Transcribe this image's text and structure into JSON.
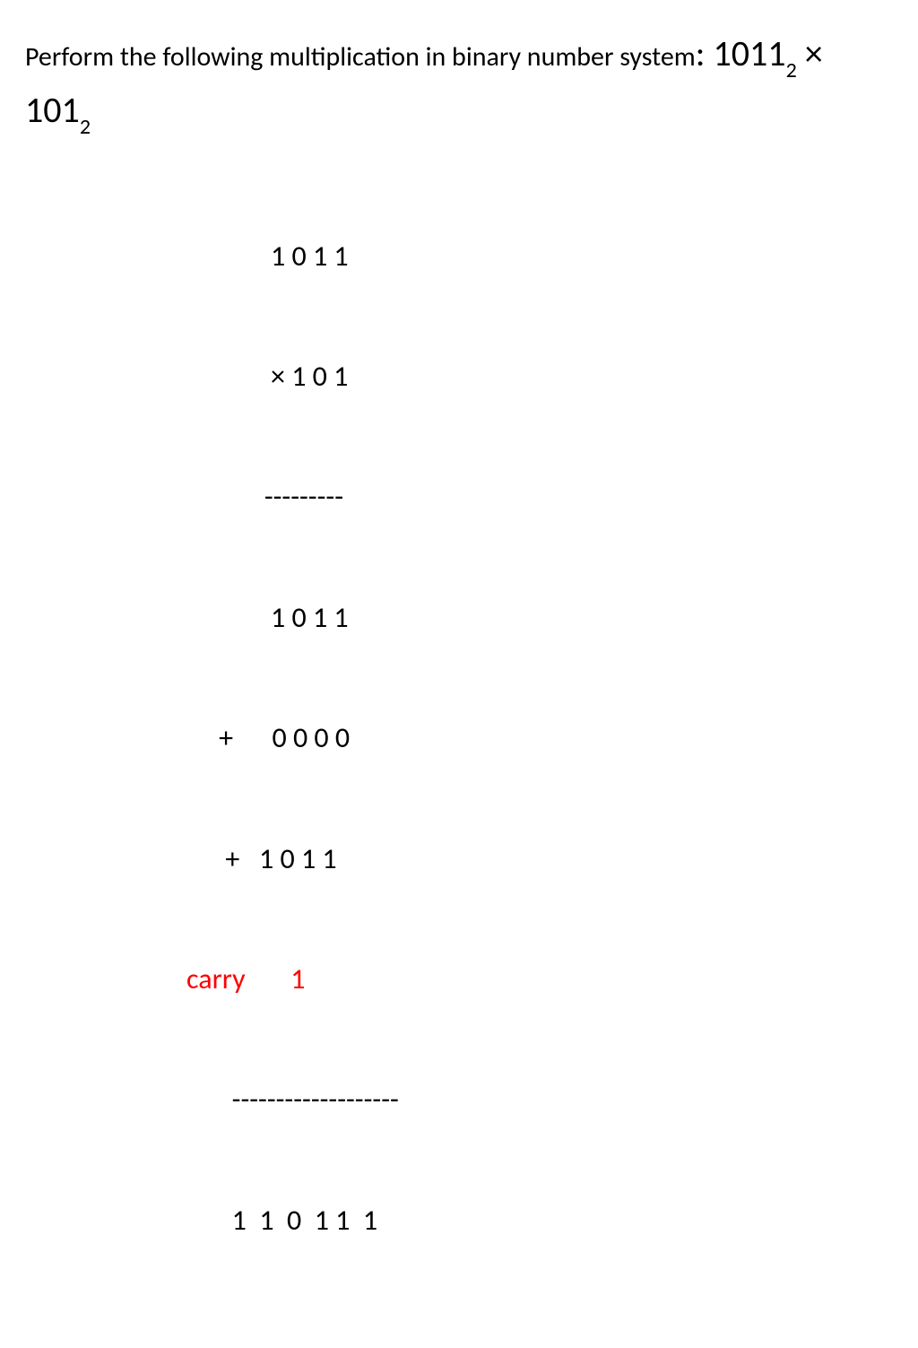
{
  "problem": {
    "text_part1": "Perform the following multiplication in binary number system",
    "colon": ": ",
    "operand1": "1011",
    "operand1_base": "2",
    "operator": "  × ",
    "operand2": "101",
    "operand2_base": "2"
  },
  "calc": {
    "line1": "             1 0 1 1",
    "line2": "             × 1 0 1",
    "line3": "            ---------",
    "line4": "             1 0 1 1",
    "line5": "     +      0 0 0 0",
    "line6": "      +   1 0 1 1",
    "carry_label": "carry",
    "carry_value": "       1",
    "line8": "       -------------------",
    "line9": "       1  1  0  1 1  1"
  }
}
